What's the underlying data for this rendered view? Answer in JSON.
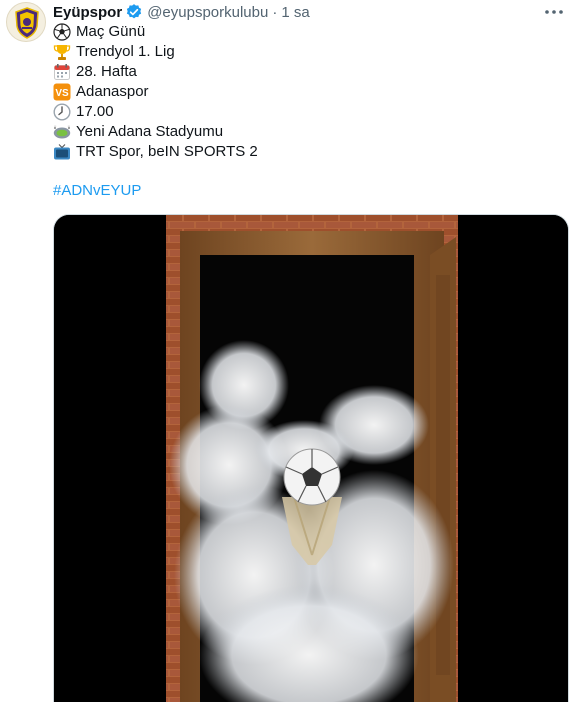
{
  "tweet": {
    "display_name": "Eyüpspor",
    "handle": "@eyupsporkulubu",
    "separator": "·",
    "time": "1 sa",
    "lines": [
      {
        "icon": "soccer-ball-icon",
        "text": "Maç Günü"
      },
      {
        "icon": "trophy-icon",
        "text": "Trendyol 1. Lig"
      },
      {
        "icon": "calendar-icon",
        "text": "28. Hafta"
      },
      {
        "icon": "vs-icon",
        "text": "Adanaspor",
        "badge": "VS"
      },
      {
        "icon": "clock-icon",
        "text": "17.00"
      },
      {
        "icon": "stadium-icon",
        "text": "Yeni Adana Stadyumu"
      },
      {
        "icon": "television-icon",
        "text": "TRT Spor, beIN SPORTS 2"
      }
    ],
    "hashtag": "#ADNvEYUP"
  },
  "colors": {
    "link": "#1d9bf0",
    "secondary_text": "#536471",
    "verified": "#1d9bf0",
    "brick": "#a0522d",
    "door_wood": "#8b5a2b"
  }
}
